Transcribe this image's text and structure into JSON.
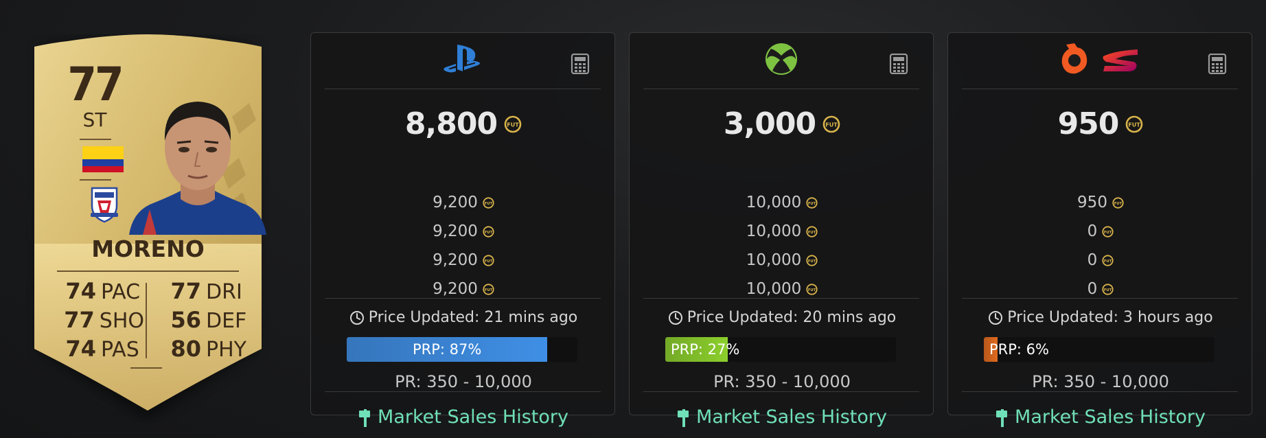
{
  "card": {
    "rating": "77",
    "position": "ST",
    "name": "MORENO",
    "stats_left": [
      {
        "value": "74",
        "label": "PAC"
      },
      {
        "value": "77",
        "label": "SHO"
      },
      {
        "value": "74",
        "label": "PAS"
      }
    ],
    "stats_right": [
      {
        "value": "77",
        "label": "DRI"
      },
      {
        "value": "56",
        "label": "DEF"
      },
      {
        "value": "80",
        "label": "PHY"
      }
    ]
  },
  "panels": [
    {
      "platform_icons": [
        "playstation-icon"
      ],
      "price": "8,800",
      "prices": [
        "9,200",
        "9,200",
        "9,200",
        "9,200"
      ],
      "updated": "Price Updated: 21 mins ago",
      "prp_label": "PRP: 87%",
      "prp_value": 87,
      "prp_color": "#3f8fe6",
      "pr": "PR: 350 - 10,000",
      "history_label": "Market Sales History"
    },
    {
      "platform_icons": [
        "xbox-icon"
      ],
      "price": "3,000",
      "prices": [
        "10,000",
        "10,000",
        "10,000",
        "10,000"
      ],
      "updated": "Price Updated: 20 mins ago",
      "prp_label": "PRP: 27%",
      "prp_value": 27,
      "prp_color": "#8ccf2c",
      "pr": "PR: 350 - 10,000",
      "history_label": "Market Sales History"
    },
    {
      "platform_icons": [
        "origin-icon",
        "stadia-icon"
      ],
      "price": "950",
      "prices": [
        "950",
        "0",
        "0",
        "0"
      ],
      "updated": "Price Updated: 3 hours ago",
      "prp_label": "PRP: 6%",
      "prp_value": 6,
      "prp_color": "#e06a1e",
      "pr": "PR: 350 - 10,000",
      "history_label": "Market Sales History"
    }
  ],
  "colors": {
    "coin": "#d9b44a",
    "link": "#6fe0b7",
    "card_gold": "#d8bf79"
  }
}
